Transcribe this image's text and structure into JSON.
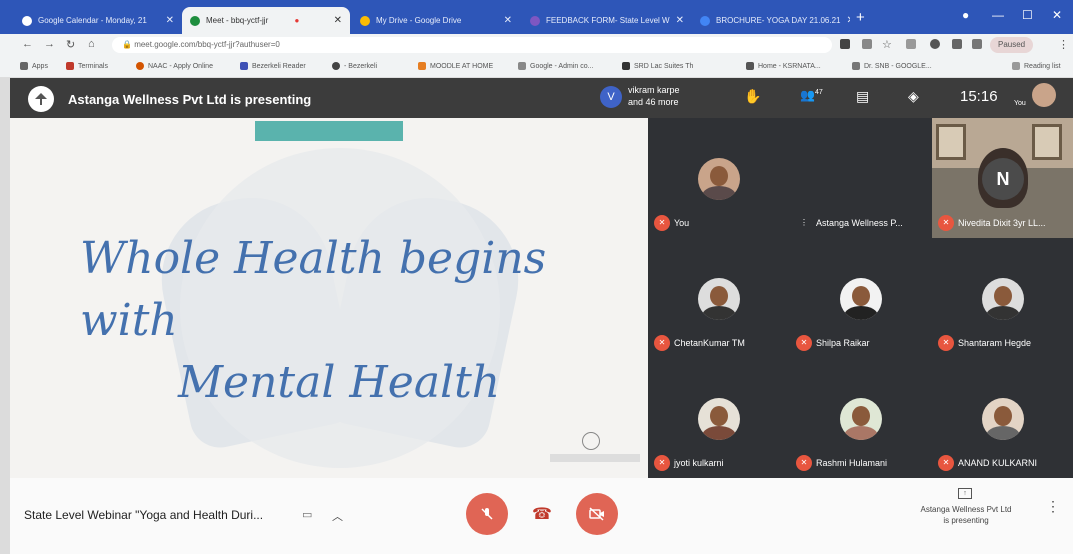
{
  "browser": {
    "tabs": [
      {
        "label": "Google Calendar - Monday, 21",
        "active": false
      },
      {
        "label": "Meet - bbq-yctf-jjr",
        "active": true
      },
      {
        "label": "My Drive - Google Drive",
        "active": false
      },
      {
        "label": "FEEDBACK FORM- State Level W",
        "active": false
      },
      {
        "label": "BROCHURE- YOGA DAY 21.06.21",
        "active": false
      }
    ],
    "url": "meet.google.com/bbq-yctf-jjr?authuser=0",
    "profile_label": "Paused",
    "bookmarks": [
      "Apps",
      "Terminals",
      "NAAC - Apply Online",
      "Bezerkeli Reader",
      "- Bezerkeli",
      "MOODLE AT HOME",
      "Google - Admin co...",
      "SRD Lac Suites Th",
      "Home - KSRNATA...",
      "Dr. SNB - GOOGLE...",
      "Reading list"
    ]
  },
  "meet": {
    "presenting_banner": "Astanga Wellness Pvt Ltd is presenting",
    "viewer_initial": "V",
    "viewer_line1": "vikram karpe",
    "viewer_line2": "and 46 more",
    "participant_count": "47",
    "time": "15:16",
    "you_label": "You",
    "slide": {
      "line1": "Whole Health begins with",
      "line2": "Mental Health"
    },
    "participants": [
      {
        "name": "You",
        "avatar": "photo"
      },
      {
        "name": "Astanga Wellness P...",
        "avatar": "video"
      },
      {
        "name": "Nivedita Dixit 3yr LL...",
        "avatar": "N"
      },
      {
        "name": "ChetanKumar TM",
        "avatar": "photo"
      },
      {
        "name": "Shilpa Raikar",
        "avatar": "photo"
      },
      {
        "name": "Shantaram Hegde",
        "avatar": "photo"
      },
      {
        "name": "jyoti kulkarni",
        "avatar": "photo"
      },
      {
        "name": "Rashmi Hulamani",
        "avatar": "photo"
      },
      {
        "name": "ANAND KULKARNI",
        "avatar": "photo"
      }
    ],
    "meeting_title": "State Level Webinar \"Yoga and Health Duri...",
    "presenter_note_line1": "Astanga Wellness Pvt Ltd",
    "presenter_note_line2": "is presenting"
  },
  "colors": {
    "tabstrip": "#2e56b8",
    "meet_dark": "#202124",
    "control_red": "#e06555",
    "slide_text": "#4471ae",
    "muted_mic": "#e8563f"
  }
}
